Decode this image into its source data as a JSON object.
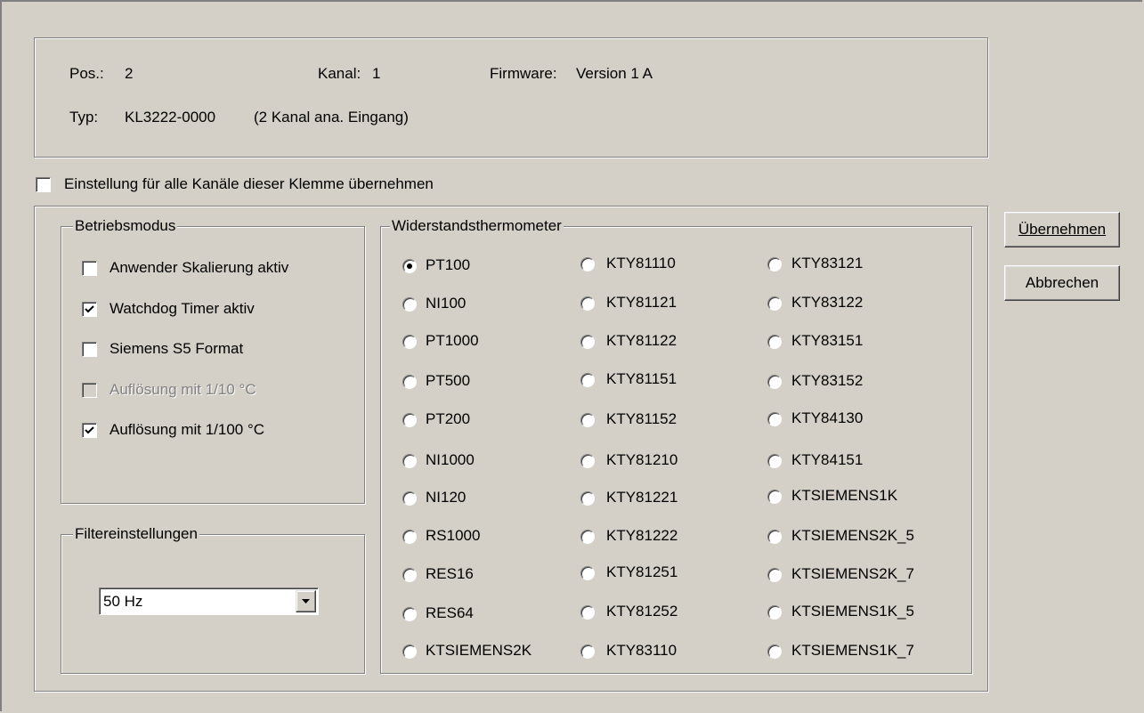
{
  "info": {
    "pos_label": "Pos.:",
    "pos_value": "2",
    "kanal_label": "Kanal:",
    "kanal_value": "1",
    "firmware_label": "Firmware:",
    "firmware_value": "Version 1 A",
    "typ_label": "Typ:",
    "typ_value": "KL3222-0000",
    "typ_desc": "(2 Kanal ana. Eingang)"
  },
  "apply_all": {
    "label": "Einstellung für alle Kanäle dieser Klemme übernehmen",
    "checked": false
  },
  "betriebsmodus": {
    "title": "Betriebsmodus",
    "options": [
      {
        "label": "Anwender Skalierung aktiv",
        "checked": false,
        "enabled": true
      },
      {
        "label": "Watchdog Timer aktiv",
        "checked": true,
        "enabled": true
      },
      {
        "label": "Siemens S5 Format",
        "checked": false,
        "enabled": true
      },
      {
        "label": "Auflösung mit 1/10 °C",
        "checked": false,
        "enabled": false
      },
      {
        "label": "Auflösung mit 1/100 °C",
        "checked": true,
        "enabled": true
      }
    ]
  },
  "filter": {
    "title": "Filtereinstellungen",
    "selected": "50 Hz"
  },
  "sensor": {
    "title": "Widerstandsthermometer",
    "selected": "PT100",
    "col1": [
      "PT100",
      "NI100",
      "PT1000",
      "PT500",
      "PT200",
      "NI1000",
      "NI120",
      "RS1000",
      "RES16",
      "RES64",
      "KTSIEMENS2K"
    ],
    "col2": [
      "KTY81110",
      "KTY81121",
      "KTY81122",
      "KTY81151",
      "KTY81152",
      "KTY81210",
      "KTY81221",
      "KTY81222",
      "KTY81251",
      "KTY81252",
      "KTY83110"
    ],
    "col3": [
      "KTY83121",
      "KTY83122",
      "KTY83151",
      "KTY83152",
      "KTY84130",
      "KTY84151",
      "KTSIEMENS1K",
      "KTSIEMENS2K_5",
      "KTSIEMENS2K_7",
      "KTSIEMENS1K_5",
      "KTSIEMENS1K_7"
    ]
  },
  "buttons": {
    "apply": "Übernehmen",
    "cancel": "Abbrechen"
  }
}
